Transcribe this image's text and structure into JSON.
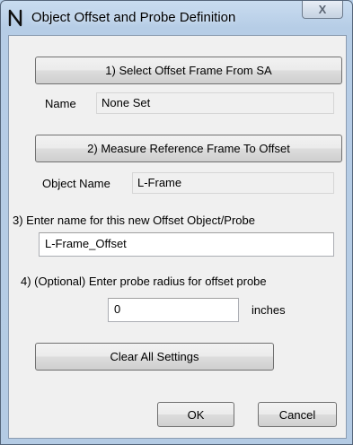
{
  "window": {
    "title": "Object Offset and Probe Definition",
    "close_label": "X"
  },
  "step1": {
    "button_label": "1) Select Offset Frame From SA",
    "name_label": "Name",
    "name_value": "None Set"
  },
  "step2": {
    "button_label": "2) Measure Reference Frame To Offset",
    "object_name_label": "Object Name",
    "object_name_value": "L-Frame"
  },
  "step3": {
    "label": "3) Enter name for this new Offset Object/Probe",
    "value": "L-Frame_Offset"
  },
  "step4": {
    "label": "4) (Optional) Enter probe radius for offset probe",
    "value": "0",
    "unit": "inches"
  },
  "actions": {
    "clear_label": "Clear All Settings",
    "ok_label": "OK",
    "cancel_label": "Cancel"
  },
  "icons": {
    "app": "probe-app-icon",
    "close": "close-icon"
  }
}
